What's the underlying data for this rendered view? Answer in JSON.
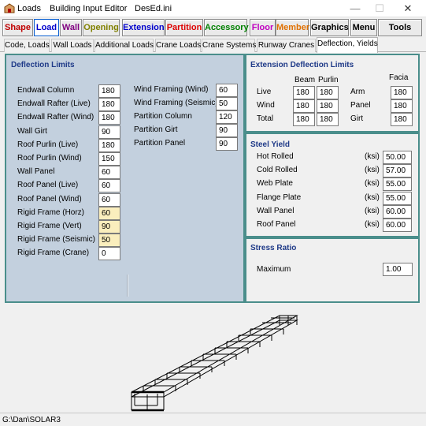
{
  "window": {
    "menu_loads": "Loads",
    "title": "Building Input Editor",
    "file": "DesEd.ini",
    "min": "—",
    "max": "☐",
    "close": "✕"
  },
  "toolbar": [
    {
      "label": "Shape",
      "color": "#c00000"
    },
    {
      "label": "Load",
      "color": "#0000cc"
    },
    {
      "label": "Wall",
      "color": "#800080"
    },
    {
      "label": "Opening",
      "color": "#808000"
    },
    {
      "label": "Extension",
      "color": "#0000cc"
    },
    {
      "label": "Partition",
      "color": "#dd0000"
    },
    {
      "label": "Accessory",
      "color": "#008000"
    },
    {
      "label": "Floor",
      "color": "#c000c0"
    },
    {
      "label": "Member",
      "color": "#e07000"
    },
    {
      "label": "Graphics",
      "color": "#000000"
    },
    {
      "label": "Menu",
      "color": "#000000"
    },
    {
      "label": "Tools",
      "color": "#000000"
    }
  ],
  "tabs": [
    "Code, Loads",
    "Wall Loads",
    "Additional Loads",
    "Crane Loads",
    "Crane Systems",
    "Runway Cranes",
    "Deflection, Yields"
  ],
  "deflection": {
    "title": "Deflection Limits",
    "left": [
      {
        "label": "Endwall Column",
        "value": "180",
        "hl": false
      },
      {
        "label": "Endwall Rafter  (Live)",
        "value": "180",
        "hl": false
      },
      {
        "label": "Endwall Rafter  (Wind)",
        "value": "180",
        "hl": false
      },
      {
        "label": "Wall Girt",
        "value": "90",
        "hl": false
      },
      {
        "label": "Roof Purlin  (Live)",
        "value": "180",
        "hl": false
      },
      {
        "label": "Roof Purlin  (Wind)",
        "value": "150",
        "hl": false
      },
      {
        "label": "Wall Panel",
        "value": "60",
        "hl": false
      },
      {
        "label": "Roof Panel  (Live)",
        "value": "60",
        "hl": false
      },
      {
        "label": "Roof Panel  (Wind)",
        "value": "60",
        "hl": false
      },
      {
        "label": "Rigid Frame  (Horz)",
        "value": "60",
        "hl": true
      },
      {
        "label": "Rigid Frame  (Vert)",
        "value": "90",
        "hl": true
      },
      {
        "label": "Rigid Frame  (Seismic)",
        "value": "50",
        "hl": true
      },
      {
        "label": "Rigid Frame  (Crane)",
        "value": "0",
        "hl": false
      }
    ],
    "right": [
      {
        "label": "Wind Framing  (Wind)",
        "value": "60"
      },
      {
        "label": "Wind Framing  (Seismic)",
        "value": "50"
      },
      {
        "label": "Partition Column",
        "value": "120"
      },
      {
        "label": "Partition Girt",
        "value": "90"
      },
      {
        "label": "Partition Panel",
        "value": "90"
      }
    ]
  },
  "extension": {
    "title": "Extension Deflection Limits",
    "col_beam": "Beam",
    "col_purlin": "Purlin",
    "col_facia": "Facia",
    "rows": [
      {
        "label": "Live",
        "beam": "180",
        "purlin": "180",
        "flabel": "Arm",
        "facia": "180"
      },
      {
        "label": "Wind",
        "beam": "180",
        "purlin": "180",
        "flabel": "Panel",
        "facia": "180"
      },
      {
        "label": "Total",
        "beam": "180",
        "purlin": "180",
        "flabel": "Girt",
        "facia": "180"
      }
    ]
  },
  "steel_yield": {
    "title": "Steel Yield",
    "unit": "(ksi)",
    "rows": [
      {
        "label": "Hot Rolled",
        "value": "50.00"
      },
      {
        "label": "Cold Rolled",
        "value": "57.00"
      },
      {
        "label": "Web Plate",
        "value": "55.00"
      },
      {
        "label": "Flange Plate",
        "value": "55.00"
      },
      {
        "label": "Wall Panel",
        "value": "60.00"
      },
      {
        "label": "Roof Panel",
        "value": "60.00"
      }
    ]
  },
  "stress_ratio": {
    "title": "Stress Ratio",
    "label": "Maximum",
    "value": "1.00"
  },
  "status": {
    "path": "G:\\Dan\\SOLAR3"
  }
}
